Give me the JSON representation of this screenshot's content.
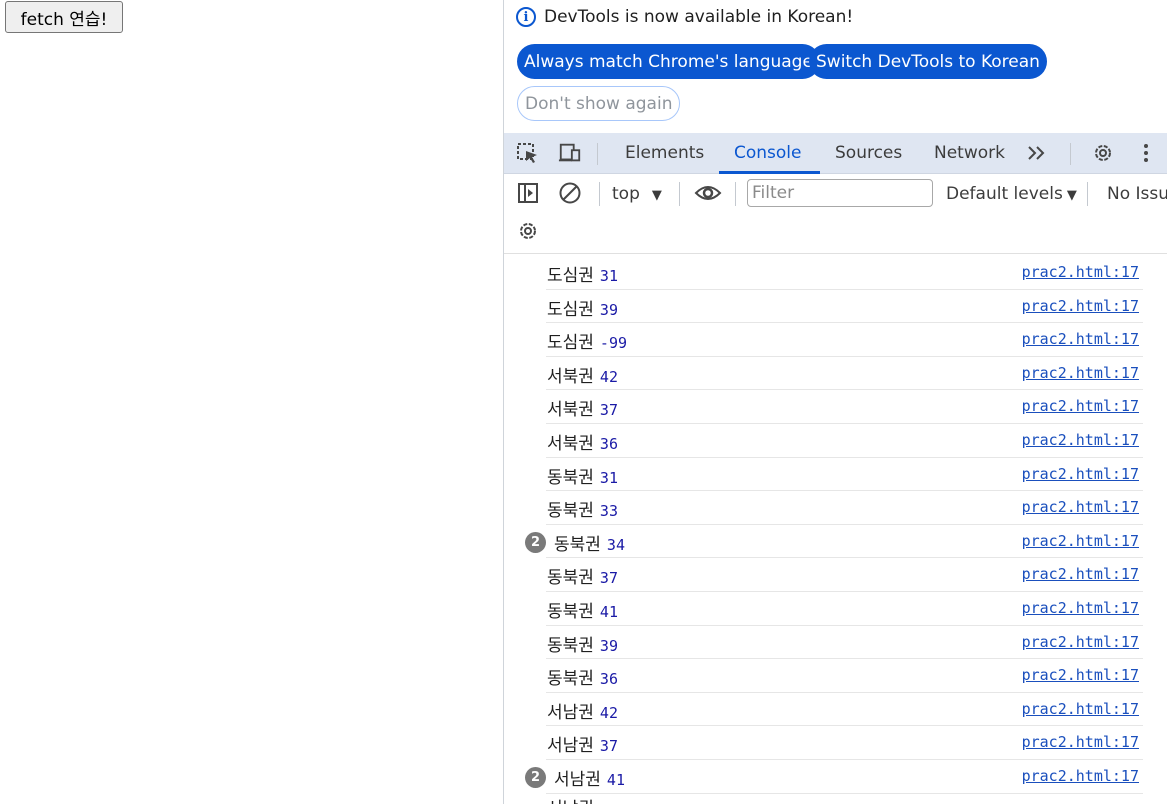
{
  "page": {
    "button_label": "fetch 연습!"
  },
  "devtools": {
    "infobar": {
      "message": "DevTools is now available in Korean!",
      "always_match_label": "Always match Chrome's language",
      "switch_label": "Switch DevTools to Korean",
      "dont_show_label": "Don't show again"
    },
    "tabs": [
      "Elements",
      "Console",
      "Sources",
      "Network"
    ],
    "active_tab": "Console",
    "toolbar": {
      "context": "top",
      "filter_placeholder": "Filter",
      "levels": "Default levels",
      "issues": "No Issu"
    },
    "console": [
      {
        "text": "도심권",
        "value": "31",
        "source": "prac2.html:17"
      },
      {
        "text": "도심권",
        "value": "39",
        "source": "prac2.html:17"
      },
      {
        "text": "도심권",
        "value": "-99",
        "source": "prac2.html:17"
      },
      {
        "text": "서북권",
        "value": "42",
        "source": "prac2.html:17"
      },
      {
        "text": "서북권",
        "value": "37",
        "source": "prac2.html:17"
      },
      {
        "text": "서북권",
        "value": "36",
        "source": "prac2.html:17"
      },
      {
        "text": "동북권",
        "value": "31",
        "source": "prac2.html:17"
      },
      {
        "text": "동북권",
        "value": "33",
        "source": "prac2.html:17"
      },
      {
        "text": "동북권",
        "value": "34",
        "source": "prac2.html:17",
        "repeat": "2"
      },
      {
        "text": "동북권",
        "value": "37",
        "source": "prac2.html:17"
      },
      {
        "text": "동북권",
        "value": "41",
        "source": "prac2.html:17"
      },
      {
        "text": "동북권",
        "value": "39",
        "source": "prac2.html:17"
      },
      {
        "text": "동북권",
        "value": "36",
        "source": "prac2.html:17"
      },
      {
        "text": "서남권",
        "value": "42",
        "source": "prac2.html:17"
      },
      {
        "text": "서남권",
        "value": "37",
        "source": "prac2.html:17"
      },
      {
        "text": "서남권",
        "value": "41",
        "source": "prac2.html:17",
        "repeat": "2"
      }
    ],
    "partial_last": "서남권"
  },
  "colors": {
    "accent": "#0b57d0",
    "tabbar_bg": "#dfe6f2",
    "number": "#1a1aa6",
    "link": "#1a4fbd"
  }
}
